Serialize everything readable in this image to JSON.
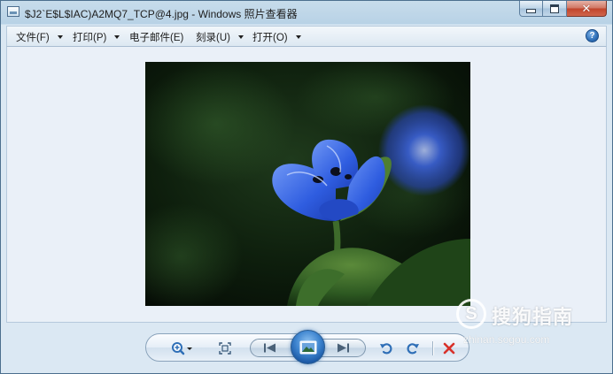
{
  "window": {
    "title": "$J2`E$L$IAC)A2MQ7_TCP@4.jpg - Windows 照片查看器"
  },
  "menu": {
    "items": [
      {
        "label": "文件(F)"
      },
      {
        "label": "打印(P)"
      },
      {
        "label": "电子邮件(E)"
      },
      {
        "label": "刻录(U)"
      },
      {
        "label": "打开(O)"
      }
    ],
    "help_glyph": "?"
  },
  "toolbar": {
    "icons": [
      "zoom-icon",
      "actual-size-icon",
      "previous-icon",
      "slideshow-icon",
      "next-icon",
      "rotate-counterclockwise-icon",
      "rotate-clockwise-icon",
      "delete-icon"
    ]
  },
  "photo": {
    "subject": "blue flower"
  },
  "watermark": {
    "glyph": "S",
    "brand": "搜狗指南",
    "url": "zhinan.sogou.com"
  },
  "colors": {
    "accent_blue": "#2f6fb7",
    "delete_red": "#d8312a",
    "flower_blue": "#3b6fe0"
  }
}
